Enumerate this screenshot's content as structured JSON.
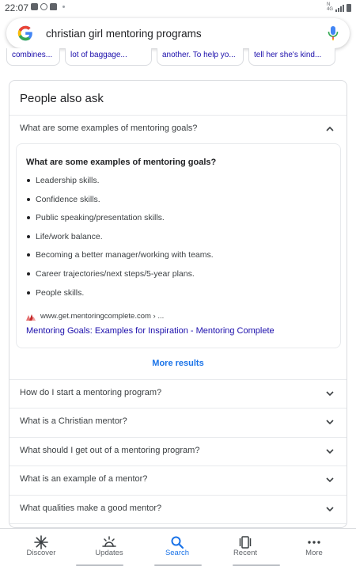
{
  "status_bar": {
    "time": "22:07"
  },
  "search": {
    "query": "christian girl mentoring programs"
  },
  "carousel": {
    "snippets": [
      "combines...",
      "lot of baggage...",
      "another. To help yo...",
      "tell her she's kind..."
    ]
  },
  "paa": {
    "heading": "People also ask",
    "expanded": {
      "question": "What are some examples of mentoring goals?",
      "answer_title": "What are some examples of mentoring goals?",
      "items": [
        "Leadership skills.",
        "Confidence skills.",
        "Public speaking/presentation skills.",
        "Life/work balance.",
        "Becoming a better manager/working with teams.",
        "Career trajectories/next steps/5-year plans.",
        "People skills."
      ],
      "source_url": "www.get.mentoringcomplete.com › ...",
      "source_title": "Mentoring Goals: Examples for Inspiration - Mentoring Complete"
    },
    "more_results": "More results",
    "questions": [
      "How do I start a mentoring program?",
      "What is a Christian mentor?",
      "What should I get out of a mentoring program?",
      "What is an example of a mentor?",
      "What qualities make a good mentor?"
    ]
  },
  "bottom_nav": {
    "items": [
      {
        "label": "Discover",
        "icon": "asterisk-icon"
      },
      {
        "label": "Updates",
        "icon": "updates-icon"
      },
      {
        "label": "Search",
        "icon": "search-icon",
        "active": true
      },
      {
        "label": "Recent",
        "icon": "recent-icon"
      },
      {
        "label": "More",
        "icon": "more-dots-icon"
      }
    ]
  },
  "colors": {
    "link": "#1a0dab",
    "accent": "#1a73e8",
    "text": "#202124",
    "muted": "#5f6368"
  }
}
